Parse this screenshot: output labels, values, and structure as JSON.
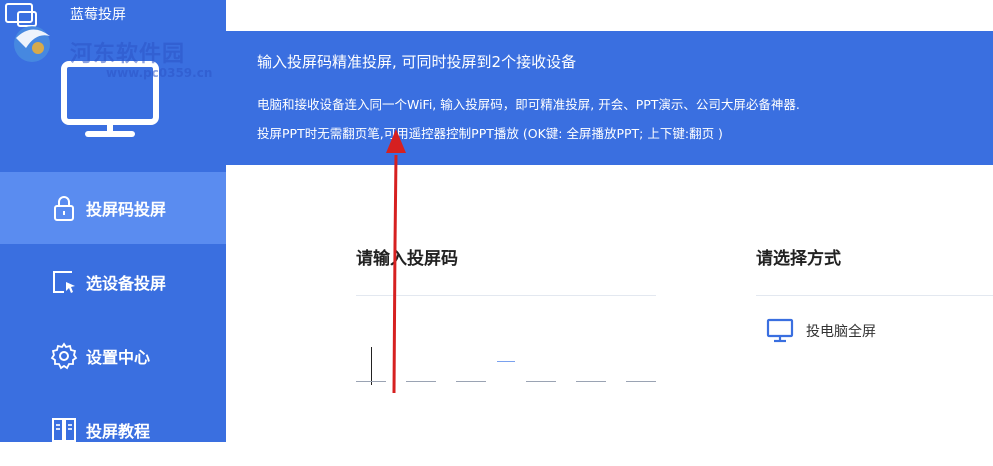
{
  "app": {
    "title": "蓝莓投屏"
  },
  "watermark": {
    "text": "河东软件园",
    "sub": "www.pc0359.cn"
  },
  "sidebar": {
    "items": [
      {
        "label": "投屏码投屏",
        "icon": "lock-icon",
        "active": true
      },
      {
        "label": "选设备投屏",
        "icon": "cursor-select-icon",
        "active": false
      },
      {
        "label": "设置中心",
        "icon": "gear-icon",
        "active": false
      },
      {
        "label": "投屏教程",
        "icon": "book-icon",
        "active": false
      }
    ]
  },
  "banner": {
    "title": "输入投屏码精准投屏, 可同时投屏到2个接收设备",
    "line1": "电脑和接收设备连入同一个WiFi, 输入投屏码，即可精准投屏, 开会、PPT演示、公司大屏必备神器.",
    "line2": "投屏PPT时无需翻页笔,可用遥控器控制PPT播放 (OK键: 全屏播放PPT; 上下键:翻页 )"
  },
  "code_section": {
    "title": "请输入投屏码",
    "value": ""
  },
  "mode_section": {
    "title": "请选择方式",
    "options": [
      {
        "label": "投电脑全屏",
        "icon": "monitor-icon"
      }
    ]
  },
  "colors": {
    "primary": "#3a6fe0",
    "active_nav": "#5a8cf0",
    "annotation": "#d62020"
  }
}
